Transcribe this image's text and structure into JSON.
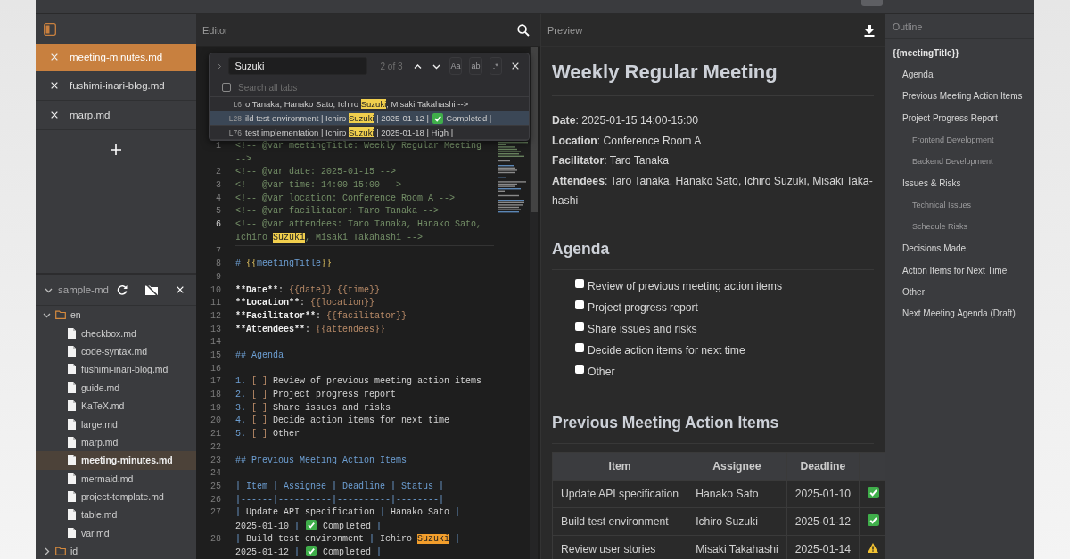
{
  "sidebar": {
    "open_tabs": [
      {
        "label": "meeting-minutes.md",
        "selected": true
      },
      {
        "label": "fushimi-inari-blog.md",
        "selected": false
      },
      {
        "label": "marp.md",
        "selected": false
      }
    ],
    "folder": {
      "name": "sample-md",
      "tree": [
        {
          "name": "en",
          "kind": "folder",
          "expanded": true,
          "children": [
            {
              "name": "checkbox.md",
              "kind": "file",
              "selected": false
            },
            {
              "name": "code-syntax.md",
              "kind": "file",
              "selected": false
            },
            {
              "name": "fushimi-inari-blog.md",
              "kind": "file",
              "selected": false
            },
            {
              "name": "guide.md",
              "kind": "file",
              "selected": false
            },
            {
              "name": "KaTeX.md",
              "kind": "file",
              "selected": false
            },
            {
              "name": "large.md",
              "kind": "file",
              "selected": false
            },
            {
              "name": "marp.md",
              "kind": "file",
              "selected": false
            },
            {
              "name": "meeting-minutes.md",
              "kind": "file",
              "selected": true
            },
            {
              "name": "mermaid.md",
              "kind": "file",
              "selected": false
            },
            {
              "name": "project-template.md",
              "kind": "file",
              "selected": false
            },
            {
              "name": "table.md",
              "kind": "file",
              "selected": false
            },
            {
              "name": "var.md",
              "kind": "file",
              "selected": false
            }
          ]
        },
        {
          "name": "id",
          "kind": "folder",
          "expanded": false
        }
      ]
    }
  },
  "editor": {
    "title": "Editor",
    "find": {
      "query": "Suzuki",
      "count": "2 of 3",
      "options": [
        "Aa",
        "ab",
        ".*"
      ],
      "search_all_tabs": {
        "label": "Search all tabs",
        "checked": false
      },
      "results": [
        {
          "line": "L6",
          "selected": false,
          "segments": [
            {
              "kind": "plain",
              "text": "o Tanaka, Hanako Sato, Ichiro "
            },
            {
              "kind": "match",
              "text": "Suzuki"
            },
            {
              "kind": "plain",
              "text": ", Misaki Takahashi -->"
            }
          ]
        },
        {
          "line": "L28",
          "selected": true,
          "segments": [
            {
              "kind": "plain",
              "text": "ild test environment | Ichiro "
            },
            {
              "kind": "match",
              "text": "Suzuki"
            },
            {
              "kind": "plain",
              "text": " | 2025-01-12 | "
            },
            {
              "kind": "check"
            },
            {
              "kind": "plain",
              "text": " Completed |"
            }
          ]
        },
        {
          "line": "L76",
          "selected": false,
          "segments": [
            {
              "kind": "plain",
              "text": "test implementation | Ichiro "
            },
            {
              "kind": "match",
              "text": "Suzuki"
            },
            {
              "kind": "plain",
              "text": " | 2025-01-18 | High |"
            }
          ]
        }
      ]
    },
    "lines": [
      {
        "n": "1",
        "active": false,
        "rows": [
          {
            "segments": [
              {
                "kind": "comment",
                "text": "<!-- @var meetingTitle: Weekly Regular Meeting"
              }
            ]
          },
          {
            "segments": [
              {
                "kind": "comment",
                "text": "-->"
              }
            ]
          }
        ]
      },
      {
        "n": "2",
        "active": false,
        "rows": [
          {
            "segments": [
              {
                "kind": "comment",
                "text": "<!-- @var date: 2025-01-15 -->"
              }
            ]
          }
        ]
      },
      {
        "n": "3",
        "active": false,
        "rows": [
          {
            "segments": [
              {
                "kind": "comment",
                "text": "<!-- @var time: 14:00-15:00 -->"
              }
            ]
          }
        ]
      },
      {
        "n": "4",
        "active": false,
        "rows": [
          {
            "segments": [
              {
                "kind": "comment",
                "text": "<!-- @var location: Conference Room A -->"
              }
            ]
          }
        ]
      },
      {
        "n": "5",
        "active": false,
        "rows": [
          {
            "segments": [
              {
                "kind": "comment",
                "text": "<!-- @var facilitator: Taro Tanaka -->"
              }
            ]
          }
        ]
      },
      {
        "n": "6",
        "active": true,
        "rows": [
          {
            "segments": [
              {
                "kind": "comment",
                "text": "<!-- @var attendees: Taro Tanaka, Hanako Sato,"
              }
            ]
          },
          {
            "segments": [
              {
                "kind": "comment",
                "text": "Ichiro "
              },
              {
                "kind": "match",
                "text": "Suzuki"
              },
              {
                "kind": "comment",
                "text": ", Misaki Takahashi -->"
              }
            ]
          }
        ]
      },
      {
        "n": "7",
        "active": false
      },
      {
        "n": "8",
        "active": false,
        "rows": [
          {
            "segments": [
              {
                "kind": "heading",
                "text": "# "
              },
              {
                "kind": "brace",
                "text": "{{"
              },
              {
                "kind": "heading",
                "text": "meetingTitle"
              },
              {
                "kind": "brace",
                "text": "}}"
              }
            ]
          }
        ]
      },
      {
        "n": "9",
        "active": false
      },
      {
        "n": "10",
        "active": false,
        "rows": [
          {
            "segments": [
              {
                "kind": "bold",
                "text": "**Date**"
              },
              {
                "kind": "plain",
                "text": ": "
              },
              {
                "kind": "var",
                "text": "{{date}} {{time}}"
              }
            ]
          }
        ]
      },
      {
        "n": "11",
        "active": false,
        "rows": [
          {
            "segments": [
              {
                "kind": "bold",
                "text": "**Location**"
              },
              {
                "kind": "plain",
                "text": ": "
              },
              {
                "kind": "var",
                "text": "{{location}}"
              }
            ]
          }
        ]
      },
      {
        "n": "12",
        "active": false,
        "rows": [
          {
            "segments": [
              {
                "kind": "bold",
                "text": "**Facilitator**"
              },
              {
                "kind": "plain",
                "text": ": "
              },
              {
                "kind": "var",
                "text": "{{facilitator}}"
              }
            ]
          }
        ]
      },
      {
        "n": "13",
        "active": false,
        "rows": [
          {
            "segments": [
              {
                "kind": "bold",
                "text": "**Attendees**"
              },
              {
                "kind": "plain",
                "text": ": "
              },
              {
                "kind": "var",
                "text": "{{attendees}}"
              }
            ]
          }
        ]
      },
      {
        "n": "14",
        "active": false
      },
      {
        "n": "15",
        "active": false,
        "rows": [
          {
            "segments": [
              {
                "kind": "heading",
                "text": "## Agenda"
              }
            ]
          }
        ]
      },
      {
        "n": "16",
        "active": false
      },
      {
        "n": "17",
        "active": false,
        "rows": [
          {
            "segments": [
              {
                "kind": "list",
                "text": "1. "
              },
              {
                "kind": "bracket",
                "text": "[ ]"
              },
              {
                "kind": "plain",
                "text": " Review of previous meeting action items"
              }
            ]
          }
        ]
      },
      {
        "n": "18",
        "active": false,
        "rows": [
          {
            "segments": [
              {
                "kind": "list",
                "text": "2. "
              },
              {
                "kind": "bracket",
                "text": "[ ]"
              },
              {
                "kind": "plain",
                "text": " Project progress report"
              }
            ]
          }
        ]
      },
      {
        "n": "19",
        "active": false,
        "rows": [
          {
            "segments": [
              {
                "kind": "list",
                "text": "3. "
              },
              {
                "kind": "bracket",
                "text": "[ ]"
              },
              {
                "kind": "plain",
                "text": " Share issues and risks"
              }
            ]
          }
        ]
      },
      {
        "n": "20",
        "active": false,
        "rows": [
          {
            "segments": [
              {
                "kind": "list",
                "text": "4. "
              },
              {
                "kind": "bracket",
                "text": "[ ]"
              },
              {
                "kind": "plain",
                "text": " Decide action items for next time"
              }
            ]
          }
        ]
      },
      {
        "n": "21",
        "active": false,
        "rows": [
          {
            "segments": [
              {
                "kind": "list",
                "text": "5. "
              },
              {
                "kind": "bracket",
                "text": "[ ]"
              },
              {
                "kind": "plain",
                "text": " Other"
              }
            ]
          }
        ]
      },
      {
        "n": "22",
        "active": false
      },
      {
        "n": "23",
        "active": false,
        "rows": [
          {
            "segments": [
              {
                "kind": "heading",
                "text": "## Previous Meeting Action Items"
              }
            ]
          }
        ]
      },
      {
        "n": "24",
        "active": false
      },
      {
        "n": "25",
        "active": false,
        "rows": [
          {
            "segments": [
              {
                "kind": "heading",
                "text": "| Item | Assignee | Deadline | Status |"
              }
            ]
          }
        ]
      },
      {
        "n": "26",
        "active": false,
        "rows": [
          {
            "segments": [
              {
                "kind": "heading",
                "text": "|------|----------|----------|--------|"
              }
            ]
          }
        ]
      },
      {
        "n": "27",
        "active": false,
        "rows": [
          {
            "segments": [
              {
                "kind": "heading",
                "text": "| "
              },
              {
                "kind": "plain",
                "text": "Update API specification "
              },
              {
                "kind": "heading",
                "text": "| "
              },
              {
                "kind": "plain",
                "text": "Hanako Sato "
              },
              {
                "kind": "heading",
                "text": "|"
              }
            ]
          },
          {
            "segments": [
              {
                "kind": "plain",
                "text": "2025-01-10 "
              },
              {
                "kind": "heading",
                "text": "| "
              },
              {
                "kind": "check"
              },
              {
                "kind": "plain",
                "text": " Completed "
              },
              {
                "kind": "heading",
                "text": "|"
              }
            ]
          }
        ]
      },
      {
        "n": "28",
        "active": false,
        "rows": [
          {
            "segments": [
              {
                "kind": "heading",
                "text": "| "
              },
              {
                "kind": "plain",
                "text": "Build test environment "
              },
              {
                "kind": "heading",
                "text": "| "
              },
              {
                "kind": "plain",
                "text": "Ichiro "
              },
              {
                "kind": "current",
                "text": "Suzuki"
              },
              {
                "kind": "heading",
                "text": " |"
              }
            ]
          },
          {
            "segments": [
              {
                "kind": "plain",
                "text": "2025-01-12 "
              },
              {
                "kind": "heading",
                "text": "| "
              },
              {
                "kind": "check"
              },
              {
                "kind": "plain",
                "text": " Completed "
              },
              {
                "kind": "heading",
                "text": "|"
              }
            ]
          }
        ]
      }
    ]
  },
  "preview": {
    "title": "Preview",
    "heading": "Weekly Regular Meeting",
    "meta": [
      "**Date**: 2025-01-15 14:00-15:00",
      "**Location**: Conference Room A",
      "**Facilitator**: Taro Tanaka",
      "**Attendees**: Taro Tanaka, Hanako Sato, Ichiro Suzuki, Misaki Taka-hashi"
    ],
    "agenda": {
      "heading": "Agenda",
      "tasks": [
        {
          "label": "Review of previous meeting action items",
          "checked": false
        },
        {
          "label": "Project progress report",
          "checked": false
        },
        {
          "label": "Share issues and risks",
          "checked": false
        },
        {
          "label": "Decide action items for next time",
          "checked": false
        },
        {
          "label": "Other",
          "checked": false
        }
      ]
    },
    "actions": {
      "heading": "Previous Meeting Action Items",
      "columns": [
        "Item",
        "Assignee",
        "Deadline"
      ],
      "rows": [
        {
          "cells": [
            "Update API specification",
            "Hanako Sato",
            "2025-01-10"
          ],
          "kind": "done"
        },
        {
          "cells": [
            "Build test environment",
            "Ichiro Suzuki",
            "2025-01-12"
          ],
          "kind": "done"
        },
        {
          "cells": [
            "Review user stories",
            "Misaki Takahashi",
            "2025-01-14"
          ],
          "kind": "warning"
        }
      ]
    }
  },
  "outline": {
    "title": "Outline",
    "items": [
      {
        "label": "{{meetingTitle}}",
        "children": [
          {
            "label": "Agenda"
          },
          {
            "label": "Previous Meeting Action Items"
          },
          {
            "label": "Project Progress Report",
            "children": [
              {
                "label": "Frontend Development"
              },
              {
                "label": "Backend Development"
              }
            ]
          },
          {
            "label": "Issues & Risks",
            "children": [
              {
                "label": "Technical Issues"
              },
              {
                "label": "Schedule Risks"
              }
            ]
          },
          {
            "label": "Decisions Made"
          },
          {
            "label": "Action Items for Next Time"
          },
          {
            "label": "Other"
          },
          {
            "label": "Next Meeting Agenda (Draft)"
          }
        ]
      }
    ]
  }
}
